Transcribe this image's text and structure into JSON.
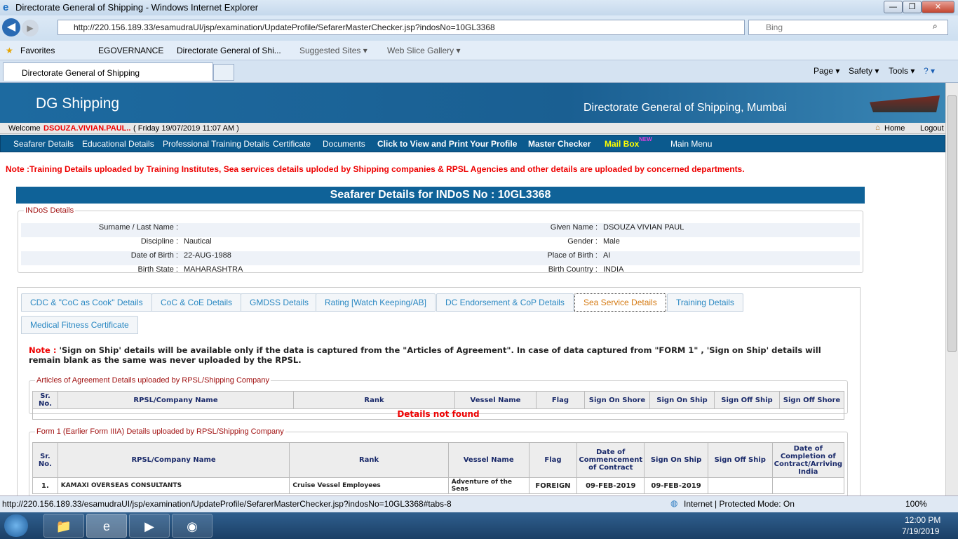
{
  "window": {
    "title": "Directorate General of Shipping - Windows Internet Explorer",
    "min": "—",
    "max": "❐",
    "close": "✕"
  },
  "address": {
    "url": "http://220.156.189.33/esamudraUI/jsp/examination/UpdateProfile/SefarerMasterChecker.jsp?indosNo=10GL3368",
    "search_placeholder": "Bing"
  },
  "favorites": {
    "label": "Favorites",
    "items": [
      "EGOVERNANCE",
      "Directorate General of Shi...",
      "Suggested Sites ▾",
      "Web Slice Gallery ▾"
    ]
  },
  "tab": {
    "label": "Directorate General of Shipping"
  },
  "commands": {
    "page": "Page ▾",
    "safety": "Safety ▾",
    "tools": "Tools ▾",
    "help": "? ▾"
  },
  "header": {
    "logo": "DG Shipping",
    "org": "Directorate General of Shipping, Mumbai"
  },
  "welcome": {
    "prefix": "Welcome",
    "user": "DSOUZA.VIVIAN.PAUL..",
    "date": "( Friday 19/07/2019 11:07 AM )",
    "home": "Home",
    "logout": "Logout"
  },
  "nav": [
    "Seafarer Details",
    "Educational Details",
    "Professional Training Details",
    "Certificate",
    "Documents",
    "Click to View and Print Your Profile",
    "Master Checker",
    "Mail Box",
    "Main Menu"
  ],
  "nav_new": "NEW",
  "note": "Note :Training Details uploaded by Training Institutes, Sea services details uploded by Shipping companies & RPSL Agencies and other details are uploaded by concerned departments.",
  "section_title": "Seafarer Details for INDoS No : 10GL3368",
  "indos": {
    "legend": "INDoS Details",
    "rows": [
      {
        "l1": "Surname / Last Name :",
        "v1": "",
        "l2": "Given Name :",
        "v2": "DSOUZA VIVIAN PAUL"
      },
      {
        "l1": "Discipline :",
        "v1": "Nautical",
        "l2": "Gender :",
        "v2": "Male"
      },
      {
        "l1": "Date of Birth :",
        "v1": "22-AUG-1988",
        "l2": "Place of Birth :",
        "v2": "AI"
      },
      {
        "l1": "Birth State :",
        "v1": "MAHARASHTRA",
        "l2": "Birth Country :",
        "v2": "INDIA"
      }
    ]
  },
  "tabs": [
    "CDC & \"CoC as Cook\" Details",
    "CoC & CoE Details",
    "GMDSS Details",
    "Rating [Watch Keeping/AB]",
    "DC Endorsement & CoP Details",
    "Sea Service Details",
    "Training Details",
    "Medical Fitness Certificate"
  ],
  "sea_note": {
    "label": "Note :",
    "text": " 'Sign on Ship' details will be available only if the data is captured from the \"Articles of Agreement\". In case of data captured from \"FORM 1\" , 'Sign on Ship' details will remain blank as the same was never uploaded by the RPSL."
  },
  "aoa": {
    "legend": "Articles of Agreement Details uploaded by RPSL/Shipping Company",
    "headers": [
      "Sr. No.",
      "RPSL/Company Name",
      "Rank",
      "Vessel Name",
      "Flag",
      "Sign On Shore",
      "Sign On Ship",
      "Sign Off Ship",
      "Sign Off Shore"
    ],
    "empty": "Details not found"
  },
  "form1": {
    "legend": "Form 1 (Earlier Form IIIA) Details uploaded by RPSL/Shipping Company",
    "headers": [
      "Sr. No.",
      "RPSL/Company Name",
      "Rank",
      "Vessel Name",
      "Flag",
      "Date of Commencement of Contract",
      "Sign On Ship",
      "Sign Off Ship",
      "Date of Completion of Contract/Arriving India"
    ],
    "rows": [
      [
        "1.",
        "KAMAXI OVERSEAS CONSULTANTS",
        "Cruise Vessel Employees",
        "Adventure of the Seas",
        "FOREIGN",
        "09-FEB-2019",
        "09-FEB-2019",
        "",
        ""
      ]
    ]
  },
  "status": {
    "url": "http://220.156.189.33/esamudraUI/jsp/examination/UpdateProfile/SefarerMasterChecker.jsp?indosNo=10GL3368#tabs-8",
    "zone": "Internet | Protected Mode: On",
    "zoom": "100%"
  },
  "clock": {
    "time": "12:00 PM",
    "date": "7/19/2019"
  }
}
